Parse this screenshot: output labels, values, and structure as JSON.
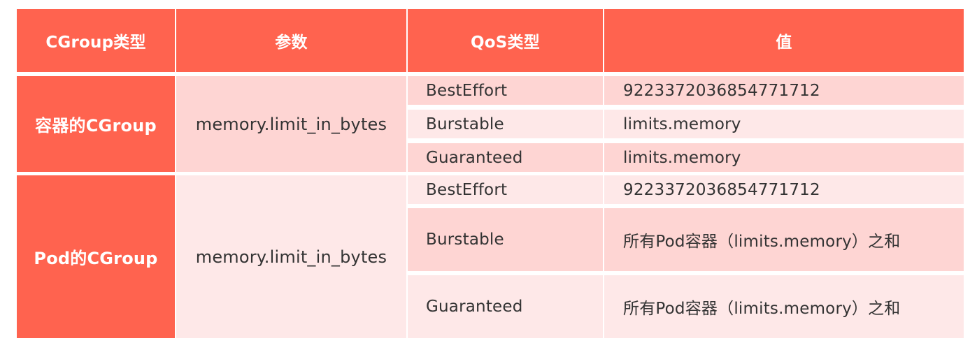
{
  "table": {
    "headers": [
      "CGroup类型",
      "参数",
      "QoS类型",
      "值"
    ],
    "groups": [
      {
        "cgroup": "容器的CGroup",
        "param": "memory.limit_in_bytes",
        "rows": [
          {
            "qos": "BestEffort",
            "value": "9223372036854771712"
          },
          {
            "qos": "Burstable",
            "value": "limits.memory"
          },
          {
            "qos": "Guaranteed",
            "value": "limits.memory"
          }
        ]
      },
      {
        "cgroup": "Pod的CGroup",
        "param": "memory.limit_in_bytes",
        "rows": [
          {
            "qos": "BestEffort",
            "value": "9223372036854771712"
          },
          {
            "qos": "Burstable",
            "value": "所有Pod容器（limits.memory）之和"
          },
          {
            "qos": "Guaranteed",
            "value": "所有Pod容器（limits.memory）之和"
          }
        ]
      }
    ]
  },
  "colors": {
    "header_bg": "#ff634f",
    "row_dark": "#fed5d3",
    "row_light": "#fee8e8",
    "text": "#333333"
  }
}
